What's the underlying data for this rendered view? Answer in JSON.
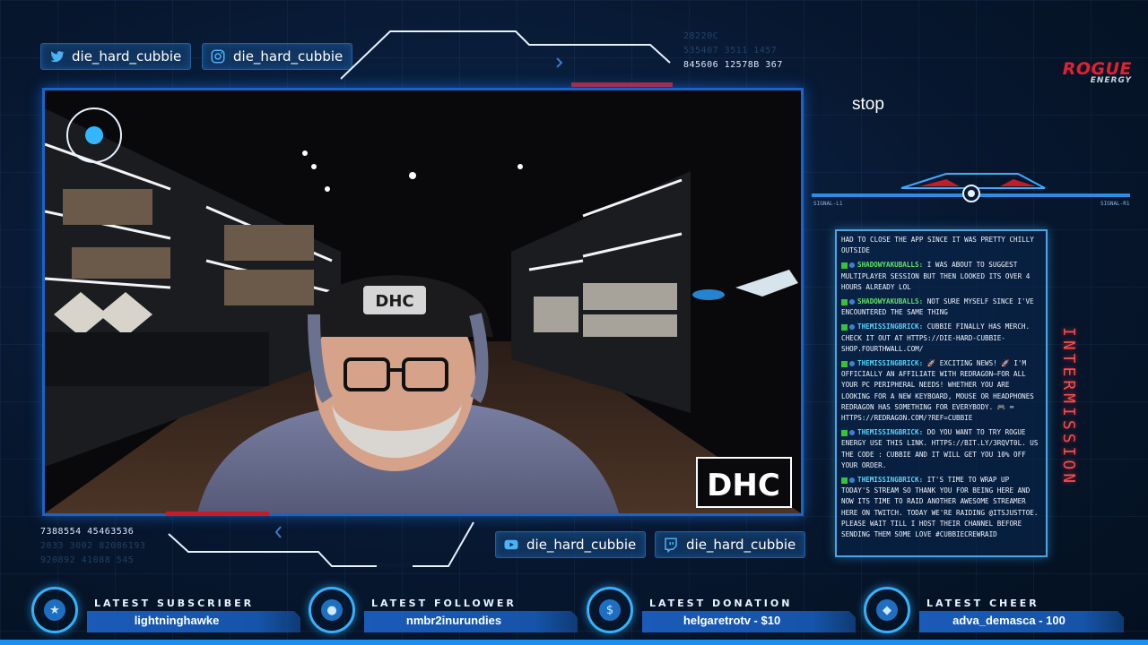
{
  "socials_top": [
    {
      "platform_icon": "twitter-icon",
      "handle": "die_hard_cubbie"
    },
    {
      "platform_icon": "instagram-icon",
      "handle": "die_hard_cubbie"
    }
  ],
  "socials_bottom": [
    {
      "platform_icon": "youtube-icon",
      "handle": "die_hard_cubbie"
    },
    {
      "platform_icon": "twitch-icon",
      "handle": "die_hard_cubbie"
    }
  ],
  "hud_codes_top": [
    "28220C",
    "535407 3511 1457",
    "845606 12578B 367"
  ],
  "hud_codes_bottom": [
    "7388554 45463536",
    "2033 3002 82086193",
    "920892 41088 545"
  ],
  "sponsor": {
    "name": "ROGUE",
    "sub": "ENERGY"
  },
  "status_text": "stop",
  "camera": {
    "logo_text": "DHC",
    "cap_text": "DHC"
  },
  "chat": {
    "messages": [
      {
        "user": "",
        "text": "had to close the app since it was pretty chilly outside"
      },
      {
        "user": "ShadowYakuballs:",
        "text": "I was about to suggest multiplayer session but then looked its over 4 hours already lol"
      },
      {
        "user": "ShadowYakuballs:",
        "text": "not sure myself since I've encountered the same thing"
      },
      {
        "user": "TheMissingBrick:",
        "text": "Cubbie finally has merch. Check it out at https://die-hard-cubbie-shop.fourthwall.com/"
      },
      {
        "user": "TheMissingBrick:",
        "text": "🚀 Exciting news! 🚀 I'm officially an affiliate with Redragon—for all your PC peripheral needs! Whether you are looking for a new keyboard, mouse or headphones Redragon has something for everybody. 🎮 ⌨ https://redragon.com/?ref=Cubbie"
      },
      {
        "user": "TheMissingBrick:",
        "text": "Do you want to try Rogue Energy use this link. https://bit.ly/3rqVT0l. Us the code : Cubbie and it will get you 10% off your order."
      },
      {
        "user": "TheMissingBrick:",
        "text": "It's time to wrap up today's stream so thank you for being here and now its time to raid another awesome streamer here on Twitch. Today we're raiding @itsjusttoe. Please wait till I host their channel before sending them some love #CubbieCrewRaid"
      }
    ]
  },
  "side_label": "INTERMISSION",
  "stats": [
    {
      "label": "LATEST SUBSCRIBER",
      "value": "lightninghawke",
      "icon": "star-icon"
    },
    {
      "label": "LATEST FOLLOWER",
      "value": "nmbr2inurundies",
      "icon": "user-icon"
    },
    {
      "label": "LATEST DONATION",
      "value": "helgaretrotv - $10",
      "icon": "dollar-icon"
    },
    {
      "label": "LATEST CHEER",
      "value": "adva_demasca - 100",
      "icon": "gem-icon"
    }
  ],
  "colors": {
    "accent": "#1b8ef0",
    "frame": "#1b63c4",
    "alert": "#ff4b4b",
    "rogue": "#e02232"
  }
}
